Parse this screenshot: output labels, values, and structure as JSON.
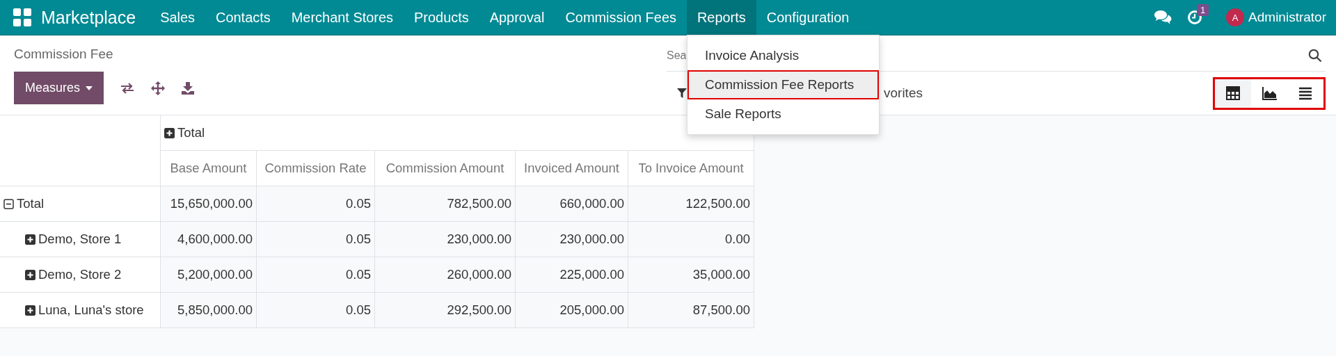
{
  "navbar": {
    "brand": "Marketplace",
    "menus": [
      {
        "label": "Sales",
        "selected": false
      },
      {
        "label": "Contacts",
        "selected": false
      },
      {
        "label": "Merchant Stores",
        "selected": false
      },
      {
        "label": "Products",
        "selected": false
      },
      {
        "label": "Approval",
        "selected": false
      },
      {
        "label": "Commission Fees",
        "selected": false
      },
      {
        "label": "Reports",
        "selected": true,
        "dropdown": [
          {
            "label": "Invoice Analysis",
            "highlighted": false
          },
          {
            "label": "Commission Fee Reports",
            "highlighted": true
          },
          {
            "label": "Sale Reports",
            "highlighted": false
          }
        ]
      },
      {
        "label": "Configuration",
        "selected": false
      }
    ],
    "activity_badge": "1",
    "user": {
      "initial": "A",
      "name": "Administrator"
    }
  },
  "control_panel": {
    "breadcrumb": "Commission Fee",
    "measures_button": "Measures",
    "search": {
      "placeholder": "Sea"
    },
    "filter_text": "vorites",
    "view_switcher": {
      "highlighted": true,
      "views": [
        {
          "kind": "pivot",
          "selected": true
        },
        {
          "kind": "graph",
          "selected": false
        },
        {
          "kind": "list",
          "selected": false
        }
      ]
    }
  },
  "pivot": {
    "column_group": "Total",
    "columns": [
      "Base Amount",
      "Commission Rate",
      "Commission Amount",
      "Invoiced Amount",
      "To Invoice Amount"
    ],
    "rows": [
      {
        "label": "Total",
        "expanded": true,
        "values": [
          "15,650,000.00",
          "0.05",
          "782,500.00",
          "660,000.00",
          "122,500.00"
        ],
        "children": [
          {
            "label": "Demo, Store 1",
            "expanded": false,
            "values": [
              "4,600,000.00",
              "0.05",
              "230,000.00",
              "230,000.00",
              "0.00"
            ]
          },
          {
            "label": "Demo, Store 2",
            "expanded": false,
            "values": [
              "5,200,000.00",
              "0.05",
              "260,000.00",
              "225,000.00",
              "35,000.00"
            ]
          },
          {
            "label": "Luna, Luna's store",
            "expanded": false,
            "values": [
              "5,850,000.00",
              "0.05",
              "292,500.00",
              "205,000.00",
              "87,500.00"
            ]
          }
        ]
      }
    ]
  }
}
